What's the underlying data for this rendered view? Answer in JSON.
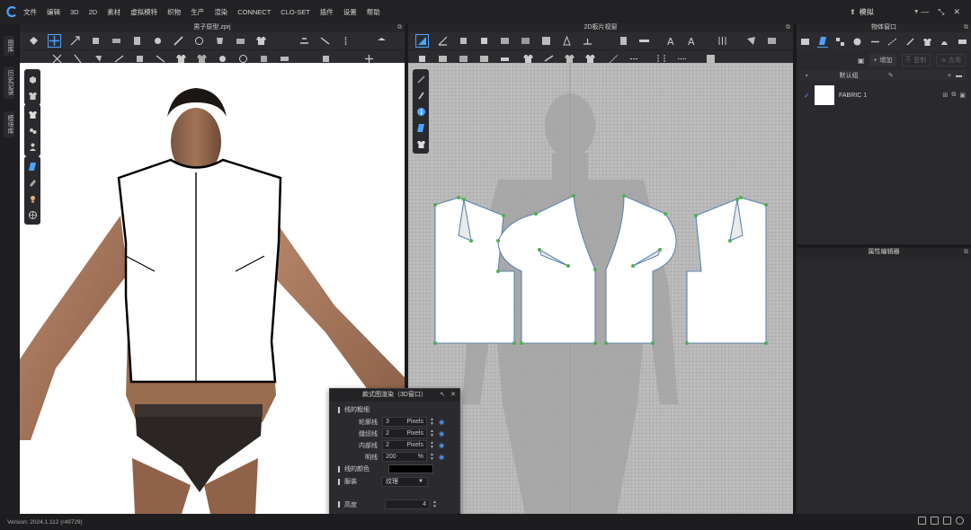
{
  "app": {
    "menu": [
      "文件",
      "编辑",
      "3D",
      "2D",
      "素材",
      "虚拟模特",
      "织物",
      "生产",
      "渲染",
      "CONNECT",
      "CLO-SET",
      "插件",
      "设置",
      "帮助"
    ],
    "workspace": "模拟",
    "accent_color": "#4da3ff"
  },
  "left_strip": {
    "tabs": [
      "图库",
      "历史记录",
      "模块库"
    ]
  },
  "view3d": {
    "title": "男子原型.zprj"
  },
  "view2d": {
    "title": "2D板片视窗"
  },
  "object_browser": {
    "title": "物体窗口",
    "add_label": "增加",
    "copy_label": "复制",
    "apply_label": "应用",
    "group_label": "默认组",
    "fabric_name": "FABRIC 1"
  },
  "property_editor": {
    "title": "属性编辑器"
  },
  "dialog": {
    "title": "款式图渲染（3D窗口）",
    "section_lines": "线的粗细",
    "rows": [
      {
        "label": "轮廓线",
        "value": "3",
        "unit": "Pixels"
      },
      {
        "label": "缝纫线",
        "value": "2",
        "unit": "Pixels"
      },
      {
        "label": "内部线",
        "value": "2",
        "unit": "Pixels"
      },
      {
        "label": "明线",
        "value": "200",
        "unit": "%"
      }
    ],
    "section_color": "线的颜色",
    "line_color": "#000000",
    "section_garment": "服装",
    "garment_value": "纹理",
    "section_height": "高度",
    "height_value": "4"
  },
  "status": {
    "version": "Version: 2024.1.112 (r49729)"
  }
}
